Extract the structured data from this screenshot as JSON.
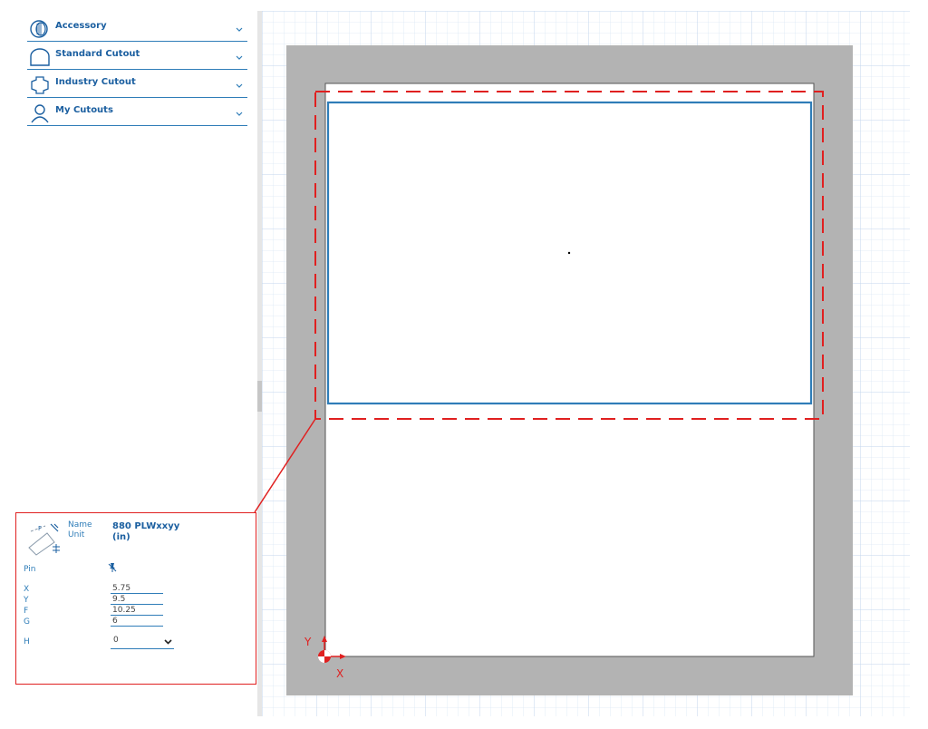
{
  "sidebar": {
    "items": [
      {
        "label": "Accessory",
        "icon": "accessory-icon"
      },
      {
        "label": "Standard Cutout",
        "icon": "standard-cutout-icon"
      },
      {
        "label": "Industry Cutout",
        "icon": "industry-cutout-icon"
      },
      {
        "label": "My Cutouts",
        "icon": "user-icon"
      }
    ]
  },
  "canvas": {
    "axis_y_label": "Y",
    "axis_x_label": "X",
    "colors": {
      "grid": "#cfe0f2",
      "border_area": "#b3b3b3",
      "cutout_outline": "#2f7db8",
      "clearance_dashed": "#e02020",
      "origin": "#e02020"
    }
  },
  "properties": {
    "name_label": "Name",
    "name_value": "880 PLWxxyy",
    "unit_label": "Unit",
    "unit_value": "(in)",
    "pin_label": "Pin",
    "fields": [
      {
        "label": "X",
        "value": "5.75"
      },
      {
        "label": "Y",
        "value": "9.5"
      },
      {
        "label": "F",
        "value": "10.25"
      },
      {
        "label": "G",
        "value": "6"
      }
    ],
    "h_label": "H",
    "h_value": "0"
  }
}
